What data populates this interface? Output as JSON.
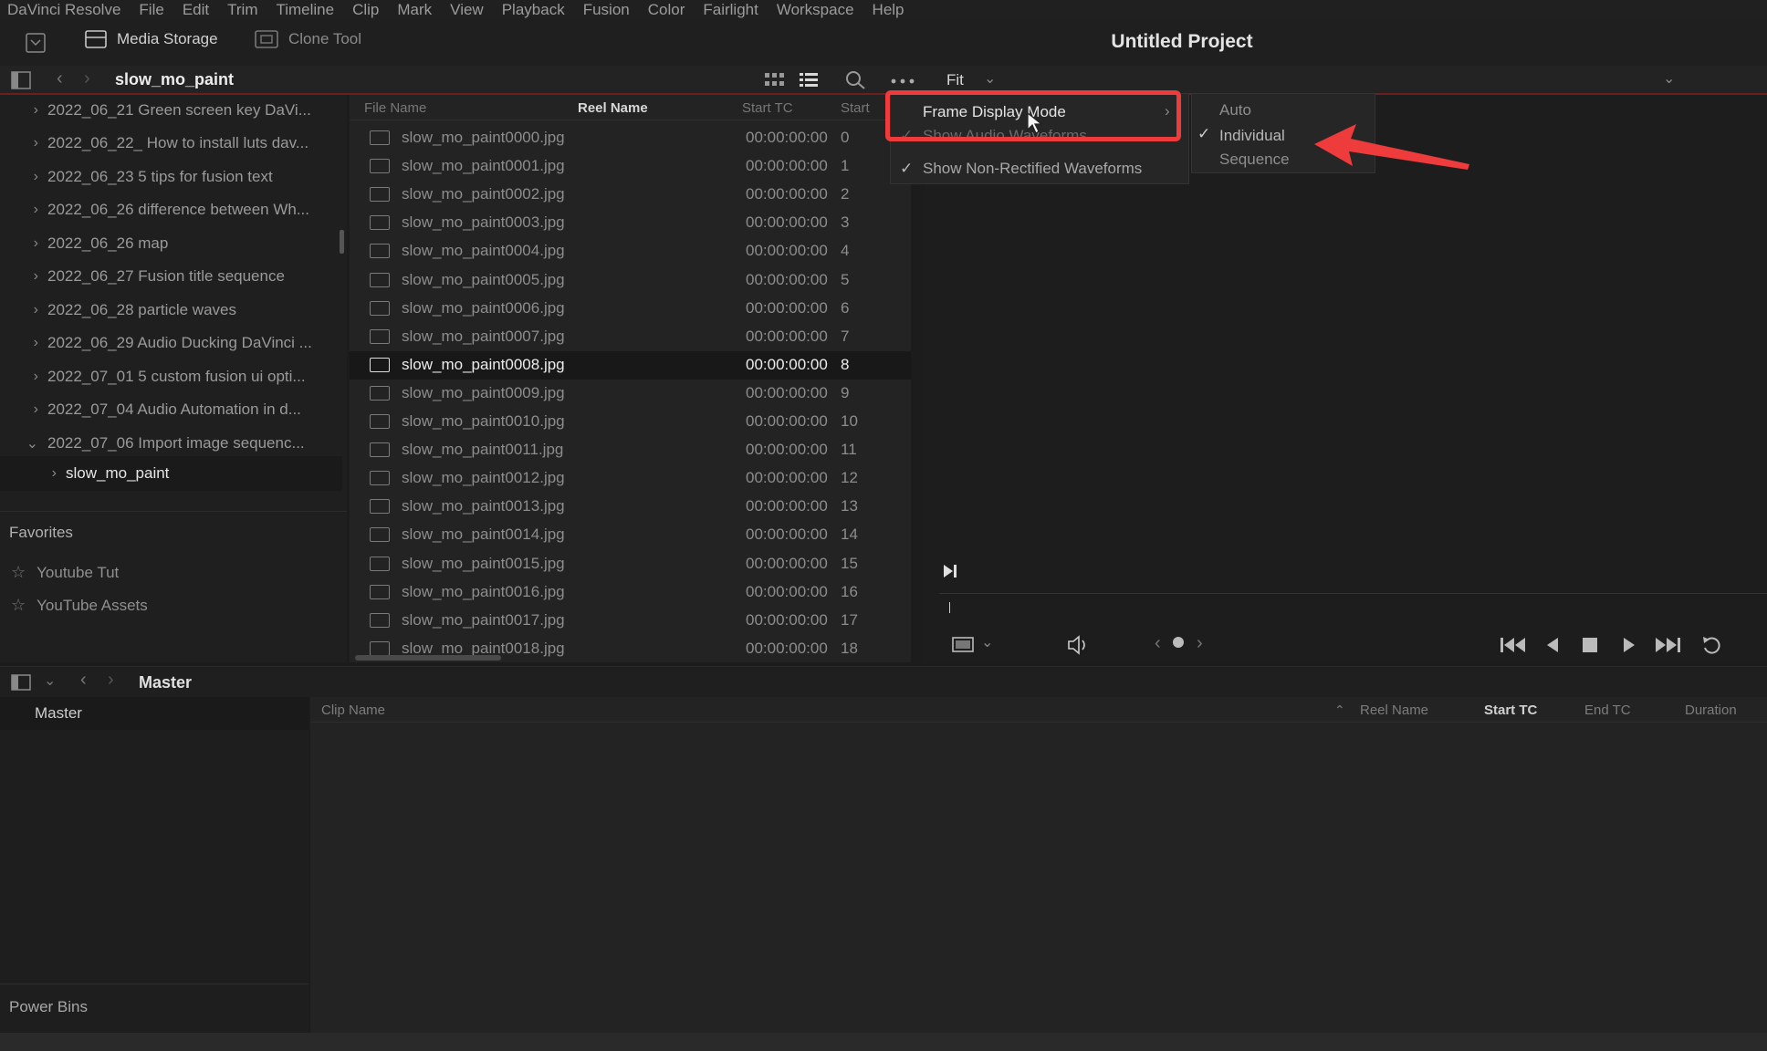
{
  "menubar": {
    "items": [
      "DaVinci Resolve",
      "File",
      "Edit",
      "Trim",
      "Timeline",
      "Clip",
      "Mark",
      "View",
      "Playback",
      "Fusion",
      "Color",
      "Fairlight",
      "Workspace",
      "Help"
    ]
  },
  "toolbar": {
    "media_storage_label": "Media Storage",
    "clone_tool_label": "Clone Tool",
    "project_title": "Untitled Project"
  },
  "pathbar": {
    "current_folder": "slow_mo_paint",
    "viewer_zoom": "Fit"
  },
  "folders": [
    {
      "label": "2022_06_21 Green screen key DaVi...",
      "expanded": false
    },
    {
      "label": "2022_06_22_ How to install luts dav...",
      "expanded": false
    },
    {
      "label": "2022_06_23 5 tips for fusion text",
      "expanded": false
    },
    {
      "label": "2022_06_26 difference between Wh...",
      "expanded": false
    },
    {
      "label": "2022_06_26 map",
      "expanded": false
    },
    {
      "label": "2022_06_27 Fusion title sequence",
      "expanded": false
    },
    {
      "label": "2022_06_28 particle waves",
      "expanded": false
    },
    {
      "label": "2022_06_29 Audio Ducking DaVinci ...",
      "expanded": false
    },
    {
      "label": "2022_07_01 5 custom fusion ui opti...",
      "expanded": false
    },
    {
      "label": "2022_07_04 Audio Automation in d...",
      "expanded": false
    },
    {
      "label": "2022_07_06 Import image sequenc...",
      "expanded": true
    }
  ],
  "subfolder": {
    "label": "slow_mo_paint"
  },
  "favorites": {
    "title": "Favorites",
    "items": [
      "Youtube Tut",
      "YouTube Assets"
    ]
  },
  "filelist": {
    "columns": [
      "File Name",
      "Reel Name",
      "Start TC",
      "Start"
    ],
    "rows": [
      {
        "name": "slow_mo_paint0000.jpg",
        "tc": "00:00:00:00",
        "start": "0"
      },
      {
        "name": "slow_mo_paint0001.jpg",
        "tc": "00:00:00:00",
        "start": "1"
      },
      {
        "name": "slow_mo_paint0002.jpg",
        "tc": "00:00:00:00",
        "start": "2"
      },
      {
        "name": "slow_mo_paint0003.jpg",
        "tc": "00:00:00:00",
        "start": "3"
      },
      {
        "name": "slow_mo_paint0004.jpg",
        "tc": "00:00:00:00",
        "start": "4"
      },
      {
        "name": "slow_mo_paint0005.jpg",
        "tc": "00:00:00:00",
        "start": "5"
      },
      {
        "name": "slow_mo_paint0006.jpg",
        "tc": "00:00:00:00",
        "start": "6"
      },
      {
        "name": "slow_mo_paint0007.jpg",
        "tc": "00:00:00:00",
        "start": "7"
      },
      {
        "name": "slow_mo_paint0008.jpg",
        "tc": "00:00:00:00",
        "start": "8"
      },
      {
        "name": "slow_mo_paint0009.jpg",
        "tc": "00:00:00:00",
        "start": "9"
      },
      {
        "name": "slow_mo_paint0010.jpg",
        "tc": "00:00:00:00",
        "start": "10"
      },
      {
        "name": "slow_mo_paint0011.jpg",
        "tc": "00:00:00:00",
        "start": "11"
      },
      {
        "name": "slow_mo_paint0012.jpg",
        "tc": "00:00:00:00",
        "start": "12"
      },
      {
        "name": "slow_mo_paint0013.jpg",
        "tc": "00:00:00:00",
        "start": "13"
      },
      {
        "name": "slow_mo_paint0014.jpg",
        "tc": "00:00:00:00",
        "start": "14"
      },
      {
        "name": "slow_mo_paint0015.jpg",
        "tc": "00:00:00:00",
        "start": "15"
      },
      {
        "name": "slow_mo_paint0016.jpg",
        "tc": "00:00:00:00",
        "start": "16"
      },
      {
        "name": "slow_mo_paint0017.jpg",
        "tc": "00:00:00:00",
        "start": "17"
      },
      {
        "name": "slow_mo_paint0018.jpg",
        "tc": "00:00:00:00",
        "start": "18"
      }
    ],
    "selected_index": 8
  },
  "context_menu": {
    "frame_display_mode": "Frame Display Mode",
    "show_audio_waveforms": "Show Audio Waveforms",
    "show_non_rectified": "Show Non-Rectified Waveforms"
  },
  "submenu": {
    "items": [
      "Auto",
      "Individual",
      "Sequence"
    ],
    "checked": "Individual"
  },
  "bottom": {
    "bin_title": "Master",
    "master_item": "Master",
    "power_bins": "Power Bins",
    "columns": [
      "Clip Name",
      "Reel Name",
      "Start TC",
      "End TC",
      "Duration"
    ]
  },
  "colors": {
    "annotation_red": "#ee3b3b",
    "background": "#1c1c1c"
  }
}
